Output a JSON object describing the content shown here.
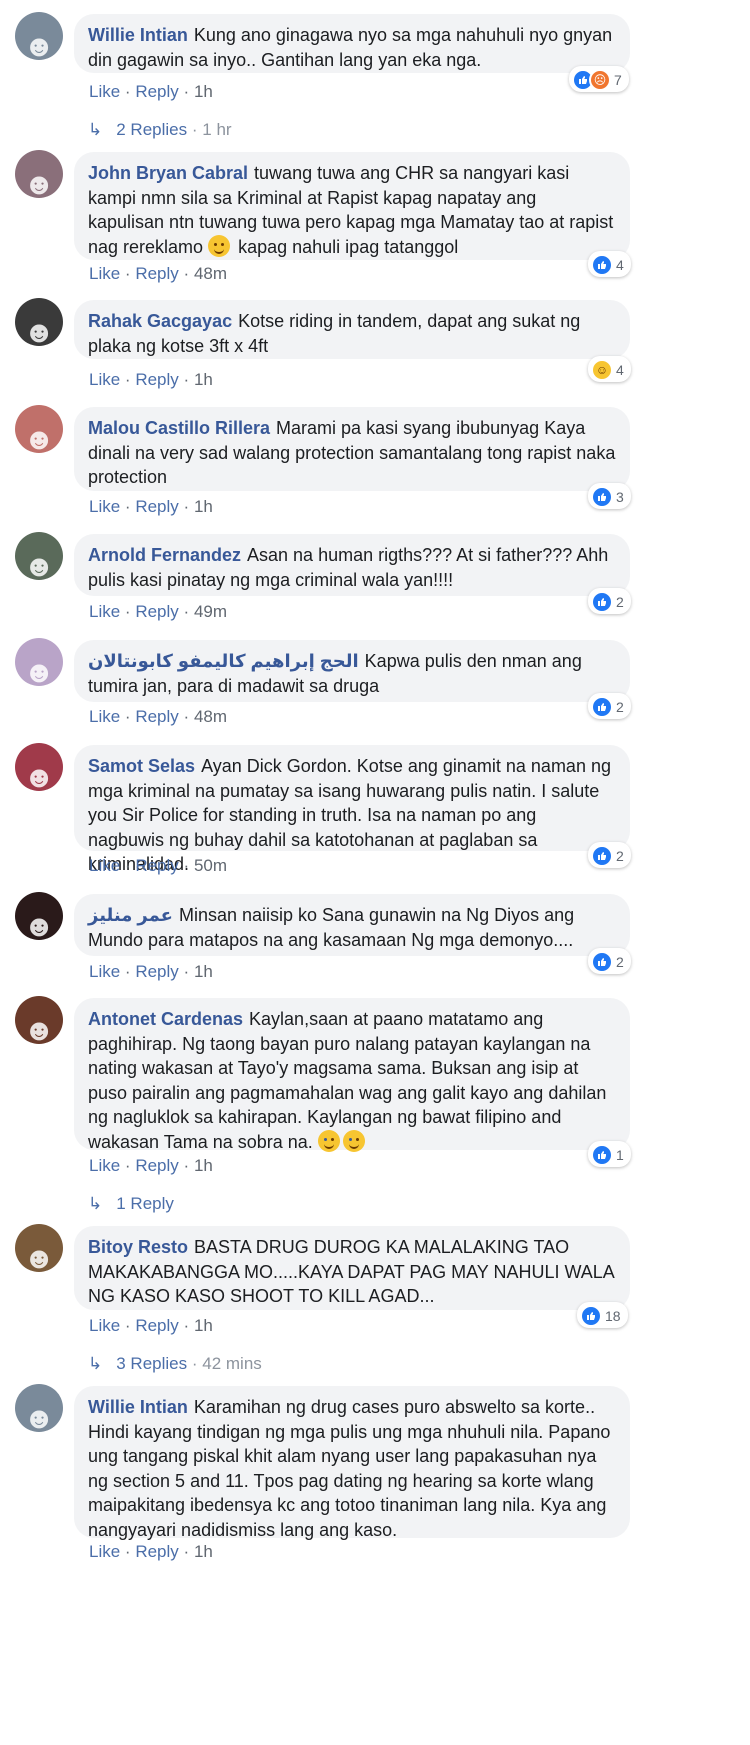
{
  "actions": {
    "like": "Like",
    "reply": "Reply",
    "sep": "·"
  },
  "comments": [
    {
      "author": "Willie Intian",
      "text": "Kung ano ginagawa nyo sa mga nahuhuli nyo gnyan din gagawin sa inyo.. Gantihan lang yan eka nga.",
      "time": "1h",
      "reaction_count": "7",
      "reactions": [
        "like-icon",
        "angry-icon"
      ],
      "replies": "2 Replies",
      "replies_time": "1 hr"
    },
    {
      "author": "John Bryan Cabral",
      "text": "tuwang tuwa ang CHR sa nangyari kasi kampi nmn sila sa Kriminal at Rapist kapag napatay ang kapulisan ntn tuwang tuwa pero kapag mga Mamatay tao at rapist nag rereklamo",
      "text_after": "kapag nahuli ipag tatanggol",
      "time": "48m",
      "reaction_count": "4",
      "reactions": [
        "like-icon"
      ]
    },
    {
      "author": "Rahak Gacgayac",
      "text": "Kotse riding in tandem, dapat ang sukat ng plaka ng kotse 3ft x 4ft",
      "time": "1h",
      "reaction_count": "4",
      "reactions": [
        "haha-icon"
      ]
    },
    {
      "author": "Malou Castillo Rillera",
      "text": "Marami pa kasi syang ibubunyag Kaya dinali na very sad walang protection samantalang tong rapist naka protection",
      "time": "1h",
      "reaction_count": "3",
      "reactions": [
        "like-icon"
      ]
    },
    {
      "author": "Arnold Fernandez",
      "text": "Asan na human rigths??? At si father??? Ahh pulis kasi pinatay ng mga criminal wala yan!!!!",
      "time": "49m",
      "reaction_count": "2",
      "reactions": [
        "like-icon"
      ]
    },
    {
      "author": "الحج إبراهيم كاليمفو كابونتالان",
      "text": "Kapwa pulis den nman ang tumira jan, para di madawit sa druga",
      "time": "48m",
      "reaction_count": "2",
      "reactions": [
        "like-icon"
      ]
    },
    {
      "author": "Samot Selas",
      "text": "Ayan Dick Gordon. Kotse ang ginamit na naman ng mga kriminal na pumatay sa isang huwarang pulis natin. I salute you Sir Police for standing in truth. Isa na naman po ang nagbuwis ng buhay dahil sa katotohanan at paglaban sa kriminalidad.",
      "time": "50m",
      "reaction_count": "2",
      "reactions": [
        "like-icon"
      ]
    },
    {
      "author": "عمر منليز",
      "text": "Minsan naiisip ko Sana gunawin na Ng Diyos ang Mundo para matapos na ang kasamaan Ng mga demonyo....",
      "time": "1h",
      "reaction_count": "2",
      "reactions": [
        "like-icon"
      ]
    },
    {
      "author": "Antonet Cardenas",
      "text": "Kaylan,saan at paano matatamo ang paghihirap. Ng taong bayan puro nalang patayan kaylangan na nating wakasan at Tayo'y magsama sama. Buksan ang isip at puso pairalin ang pagmamahalan wag ang galit kayo ang dahilan ng nagluklok sa kahirapan. Kaylangan ng bawat filipino and wakasan Tama na sobra na.",
      "time": "1h",
      "reaction_count": "1",
      "reactions": [
        "like-icon"
      ],
      "replies": "1 Reply"
    },
    {
      "author": "Bitoy Resto",
      "text": "BASTA DRUG DUROG KA MALALAKING TAO MAKAKABANGGA MO.....KAYA DAPAT PAG MAY NAHULI WALA NG KASO KASO SHOOT TO KILL AGAD...",
      "time": "1h",
      "reaction_count": "18",
      "reactions": [
        "like-icon"
      ],
      "replies": "3 Replies",
      "replies_time": "42 mins"
    },
    {
      "author": "Willie Intian",
      "text": "Karamihan ng drug cases puro abswelto sa korte.. Hindi kayang tindigan ng mga pulis ung mga nhuhuli nila. Papano ung tangang piskal khit alam nyang user lang papakasuhan nya ng section 5 and 11. Tpos pag dating ng hearing sa korte wlang maipakitang ibedensya kc ang totoo tinaniman lang nila. Kya ang nangyayari nadidismiss lang ang kaso.",
      "time": "1h"
    }
  ],
  "colors": {
    "link": "#385898",
    "bubble": "#f2f3f5",
    "like": "#2078f4",
    "angry": "#f0762f",
    "haha": "#f7c531"
  }
}
